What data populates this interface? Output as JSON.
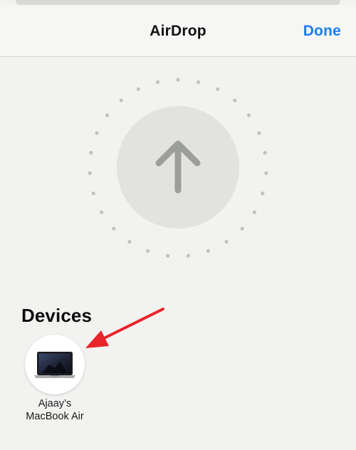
{
  "header": {
    "title": "AirDrop",
    "done_label": "Done"
  },
  "upload_button": {
    "icon": "arrow-up-icon"
  },
  "devices": {
    "section_title": "Devices",
    "items": [
      {
        "name_line1": "Ajaay’s",
        "name_line2": "MacBook Air",
        "icon": "macbook-icon"
      }
    ]
  },
  "colors": {
    "accent": "#1a7ef2",
    "annotation": "#e8232a",
    "background": "#f2f2f0",
    "radar_dots": "#c2c2c0",
    "upload_circle": "#e2e3e0",
    "upload_arrow": "#9c9e9c"
  }
}
